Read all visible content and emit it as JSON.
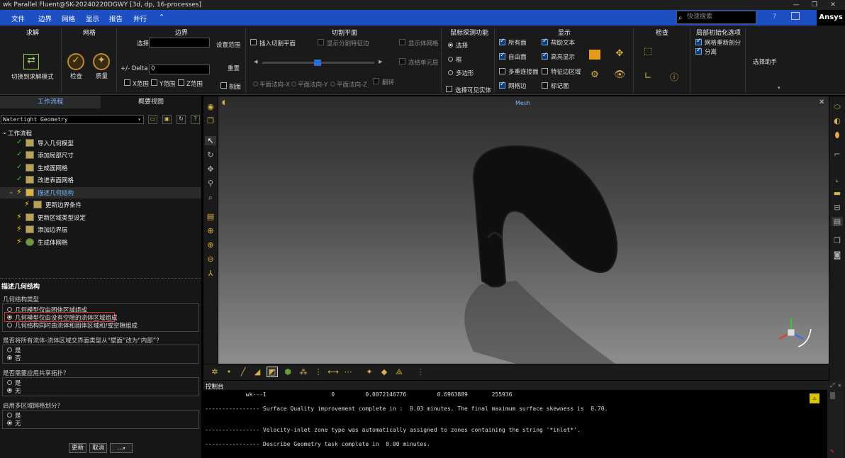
{
  "window": {
    "title": "wk Parallel Fluent@SK-20240220DGWY  [3d, dp, 16-processes]",
    "min": "—",
    "max": "❐",
    "close": "✕"
  },
  "menu": {
    "items": [
      "文件",
      "边界",
      "网格",
      "显示",
      "报告",
      "并行",
      "⌃"
    ],
    "search_placeholder": "快速搜索",
    "brand": "Ansys"
  },
  "ribbon": {
    "solution": {
      "title": "求解",
      "switch_label": "切换到求解模式"
    },
    "mesh": {
      "title": "网格",
      "check_label": "检查",
      "quality_label": "质量"
    },
    "boundary": {
      "title": "边界",
      "select_label": "选择",
      "set_range_label": "设置范围",
      "delta_label": "+/- Delta",
      "delta_value": "0",
      "reset_label": "重置",
      "x_range": "X范围",
      "y_range": "Y范围",
      "z_range": "Z范围",
      "section_label": "剖面"
    },
    "cut_plane": {
      "title": "切割平面",
      "insert_label": "插入切割平面",
      "show_edges_label": "显示分割特征边",
      "show_mesh_label": "显示体网格",
      "freeze_label": "冻结单元层",
      "plane_x": "平面法向-X",
      "plane_y": "平面法向-Y",
      "plane_z": "平面法向-Z",
      "flip_label": "翻转"
    },
    "probe": {
      "title": "鼠标探测功能",
      "select": "选择",
      "box": "框",
      "polygon": "多边形",
      "show_visible": "选择可见实体"
    },
    "display": {
      "title": "显示",
      "all_faces": "所有面",
      "free_faces": "自由面",
      "multi_faces": "多重连接面",
      "mesh_edges": "网格边",
      "help_text": "帮助文本",
      "highlight": "高亮显示",
      "feature_edges": "特征边区域",
      "markers": "标记面"
    },
    "check": {
      "title": "检查"
    },
    "local": {
      "title": "局部初始化选项",
      "remesh": "网格重新剖分",
      "split": "分离",
      "assistant": "选择助手"
    }
  },
  "left": {
    "tab_workflow": "工作流程",
    "tab_outline": "概要视图",
    "dropdown": "Watertight Geometry",
    "tree_root": "工作流程",
    "tasks": [
      "导入几何模型",
      "添加局部尺寸",
      "生成面网格",
      "改进表面网格",
      "描述几何结构",
      "更新边界条件",
      "更新区域类型设定",
      "添加边界层",
      "生成体网格"
    ],
    "panel_title": "描述几何结构",
    "geom_type_label": "几何结构类型",
    "geom_options": [
      "几何模型仅由固体区域组成",
      "几何模型仅由没有空隙的流体区域组成",
      "几何结构同时由流体和固体区域和/或空隙组成"
    ],
    "q1": "是否将所有流体-流体区域交界面类型从“壁面”改为“内部”？",
    "q2": "是否需要应用共享拓扑？",
    "q3": "启用多区域网格划分？",
    "yes": "是",
    "no": "否",
    "none": "无",
    "update_btn": "更新",
    "cancel_btn": "取消",
    "more_btn": "..."
  },
  "viewport": {
    "title": "Mesh"
  },
  "console": {
    "title": "控制台",
    "lines": [
      "            wk---1                   0         0.0072146776         0.6963889       255936",
      "",
      "---------------- Surface Quality improvement complete in :  0.03 minutes. The final maximum surface skewness is  0.70.",
      "",
      "",
      "---------------- Velocity-inlet zone type was automatically assigned to zones containing the string '*inlet*'.",
      "",
      "---------------- Describe Geometry task complete in  0.00 minutes."
    ]
  },
  "colors": {
    "menubar": "#1d4fc3",
    "highlight_box": "#e03030",
    "accent": "#3c3"
  }
}
